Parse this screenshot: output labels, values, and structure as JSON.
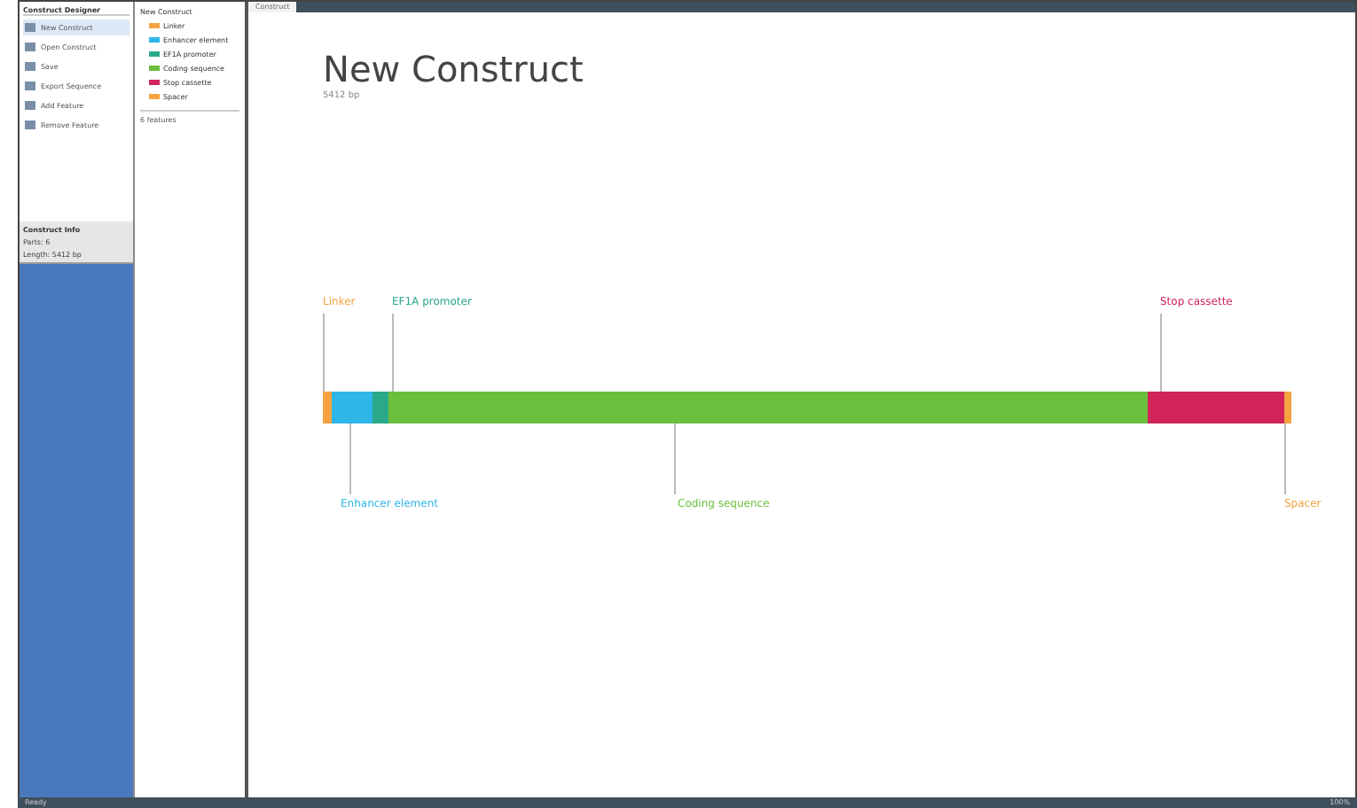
{
  "sidebar": {
    "header": "Construct Designer",
    "items": [
      {
        "label": "New Construct",
        "selected": true
      },
      {
        "label": "Open Construct",
        "selected": false
      },
      {
        "label": "Save",
        "selected": false
      },
      {
        "label": "Export Sequence",
        "selected": false
      },
      {
        "label": "Add Feature",
        "selected": false
      },
      {
        "label": "Remove Feature",
        "selected": false
      }
    ],
    "section_title": "Construct Info",
    "section_items": [
      "Parts: 6",
      "Length: 5412 bp"
    ]
  },
  "tree": {
    "root": "New Construct",
    "children": [
      {
        "label": "Linker",
        "color": "#f4a340"
      },
      {
        "label": "Enhancer element",
        "color": "#2fb6e8"
      },
      {
        "label": "EF1A promoter",
        "color": "#2aa88a"
      },
      {
        "label": "Coding sequence",
        "color": "#6abf3c"
      },
      {
        "label": "Stop cassette",
        "color": "#d0245a"
      },
      {
        "label": "Spacer",
        "color": "#f4a340"
      }
    ],
    "footer": "6 features"
  },
  "tab": "Construct",
  "title": "New Construct",
  "subtitle": "5412 bp",
  "map": {
    "top_labels": [
      {
        "label": "Linker",
        "color": "#f4a340"
      },
      {
        "label": "EF1A promoter",
        "color": "#2aa88a"
      },
      {
        "label": "Stop cassette",
        "color": "#d0245a"
      }
    ],
    "segments": [
      {
        "color": "#f4a340"
      },
      {
        "color": "#2fb6e8"
      },
      {
        "color": "#2aa88a"
      },
      {
        "color": "#6abf3c"
      },
      {
        "color": "#d0245a"
      },
      {
        "color": "#f4a340"
      }
    ],
    "bottom_labels": [
      {
        "label": "Enhancer element",
        "color": "#2fb6e8"
      },
      {
        "label": "Coding sequence",
        "color": "#6abf3c"
      },
      {
        "label": "Spacer",
        "color": "#f4a340"
      }
    ]
  },
  "status": "Ready",
  "corner": "100%"
}
